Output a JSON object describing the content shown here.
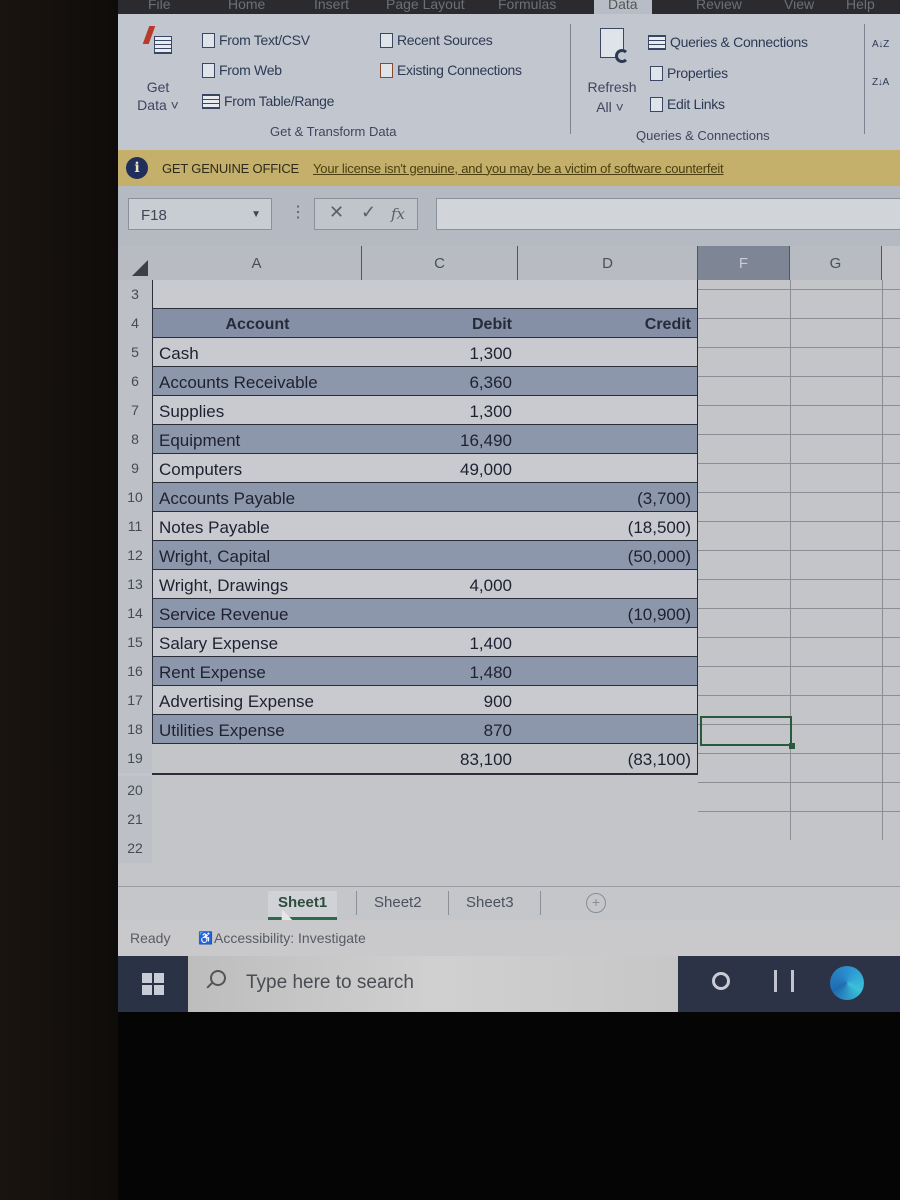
{
  "menu_tabs": [
    "File",
    "Home",
    "Insert",
    "Page Layout",
    "Formulas",
    "Data",
    "Review",
    "View",
    "Help"
  ],
  "active_menu_tab": "Data",
  "ribbon": {
    "get_transform": {
      "get_data_label_1": "Get",
      "get_data_label_2": "Data ˅",
      "from_text_csv": "From Text/CSV",
      "from_web": "From Web",
      "from_table_range": "From Table/Range",
      "recent_sources": "Recent Sources",
      "existing_connections": "Existing Connections",
      "group_label": "Get & Transform Data"
    },
    "queries": {
      "refresh_all_1": "Refresh",
      "refresh_all_2": "All ˅",
      "queries_connections": "Queries & Connections",
      "properties": "Properties",
      "edit_links": "Edit Links",
      "group_label": "Queries & Connections"
    },
    "sort_az": "A↓Z",
    "sort_za": "Z↓A"
  },
  "notice": {
    "icon": "i",
    "title": "GET GENUINE OFFICE",
    "message": "Your license isn't genuine, and you may be a victim of software counterfeit"
  },
  "formula_bar": {
    "name_box": "F18",
    "cancel": "✕",
    "enter": "✓",
    "fx": "fx",
    "formula": ""
  },
  "columns": [
    "A",
    "C",
    "D",
    "F",
    "G"
  ],
  "selected_column": "F",
  "table": {
    "headers": {
      "row": "4",
      "account": "Account",
      "debit": "Debit",
      "credit": "Credit"
    },
    "rows": [
      {
        "row": "5",
        "account": "Cash",
        "debit": "1,300",
        "credit": ""
      },
      {
        "row": "6",
        "account": "Accounts Receivable",
        "debit": "6,360",
        "credit": ""
      },
      {
        "row": "7",
        "account": "Supplies",
        "debit": "1,300",
        "credit": ""
      },
      {
        "row": "8",
        "account": "Equipment",
        "debit": "16,490",
        "credit": ""
      },
      {
        "row": "9",
        "account": "Computers",
        "debit": "49,000",
        "credit": ""
      },
      {
        "row": "10",
        "account": "Accounts Payable",
        "debit": "",
        "credit": "(3,700)"
      },
      {
        "row": "11",
        "account": "Notes Payable",
        "debit": "",
        "credit": "(18,500)"
      },
      {
        "row": "12",
        "account": "Wright, Capital",
        "debit": "",
        "credit": "(50,000)"
      },
      {
        "row": "13",
        "account": "Wright, Drawings",
        "debit": "4,000",
        "credit": ""
      },
      {
        "row": "14",
        "account": "Service Revenue",
        "debit": "",
        "credit": "(10,900)"
      },
      {
        "row": "15",
        "account": "Salary Expense",
        "debit": "1,400",
        "credit": ""
      },
      {
        "row": "16",
        "account": "Rent Expense",
        "debit": "1,480",
        "credit": ""
      },
      {
        "row": "17",
        "account": "Advertising Expense",
        "debit": "900",
        "credit": ""
      },
      {
        "row": "18",
        "account": "Utilities Expense",
        "debit": "870",
        "credit": ""
      }
    ],
    "totals": {
      "row": "19",
      "debit": "83,100",
      "credit": "(83,100)"
    },
    "empty_rows": [
      "3",
      "20",
      "21",
      "22"
    ]
  },
  "sheet_tabs": [
    "Sheet1",
    "Sheet2",
    "Sheet3"
  ],
  "active_sheet": "Sheet1",
  "status": {
    "ready": "Ready",
    "accessibility": "Accessibility: Investigate"
  },
  "taskbar": {
    "search_placeholder": "Type here to search"
  }
}
